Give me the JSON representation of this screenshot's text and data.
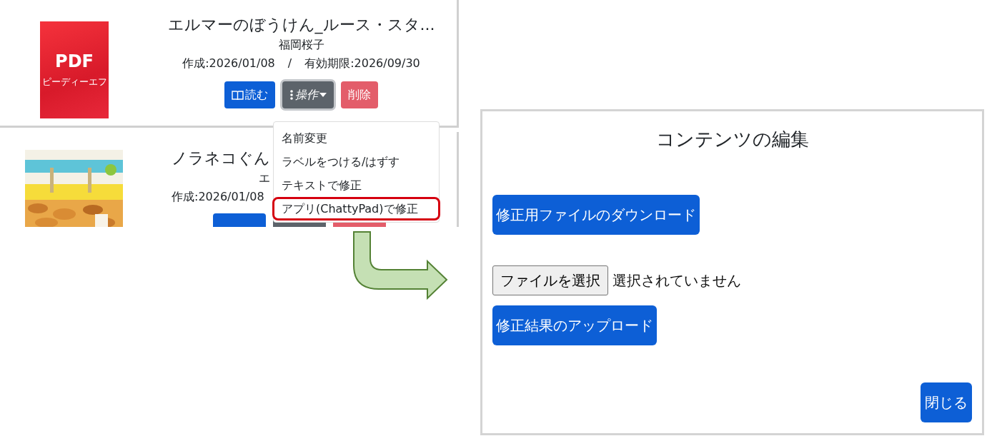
{
  "cards": [
    {
      "thumbnail": {
        "kind": "pdf",
        "label": "PDF",
        "sublabel": "ピーディーエフ"
      },
      "title": "エルマーのぼうけん_ルース・スタ...",
      "author": "福岡桜子",
      "dates": {
        "created": "作成:2026/01/08",
        "separator": "/",
        "expiry": "有効期限:2026/09/30"
      },
      "buttons": [
        {
          "kind": "read",
          "label": "読む"
        },
        {
          "kind": "actions",
          "label": "操作",
          "expanded": true
        },
        {
          "kind": "delete",
          "label": "削除"
        }
      ]
    },
    {
      "thumbnail": {
        "kind": "picture"
      },
      "title": "ノラネコぐん",
      "author": "エ",
      "dates": {
        "created": "作成:2026/01/08"
      },
      "buttons": [
        {
          "kind": "read"
        },
        {
          "kind": "actions",
          "expanded": false
        },
        {
          "kind": "delete"
        }
      ]
    }
  ],
  "dropdown": {
    "items": [
      {
        "label": "名前変更",
        "highlighted": false
      },
      {
        "label": "ラベルをつける/はずす",
        "highlighted": false
      },
      {
        "label": "テキストで修正",
        "highlighted": false
      },
      {
        "label": "アプリ(ChattyPad)で修正",
        "highlighted": true
      }
    ]
  },
  "dialog": {
    "title": "コンテンツの編集",
    "download_button": "修正用ファイルのダウンロード",
    "file_button": "ファイルを選択",
    "file_status": "選択されていません",
    "upload_button": "修正結果のアップロード",
    "close_button": "閉じる"
  }
}
